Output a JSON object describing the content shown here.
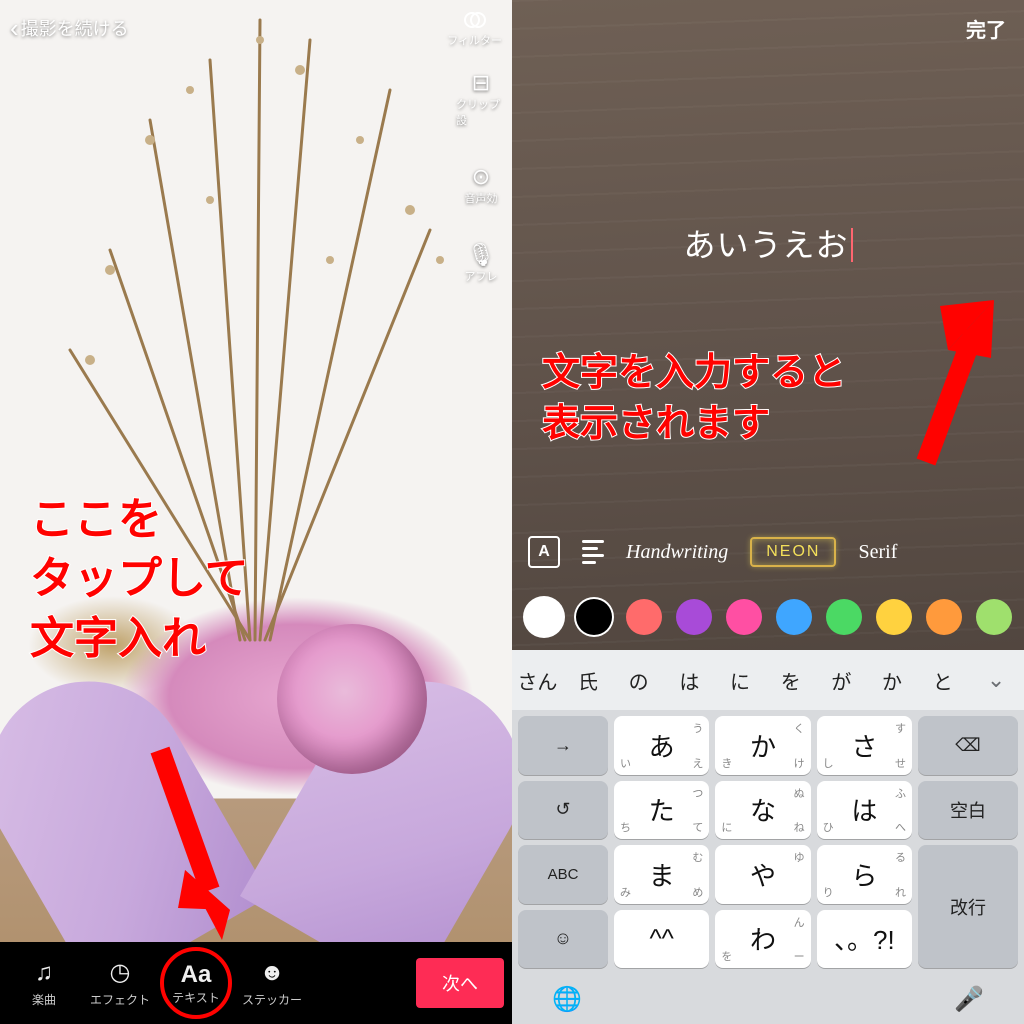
{
  "left": {
    "header": {
      "continue": "撮影を続ける",
      "filter": "フィルター"
    },
    "side_tools": {
      "clip": "クリップ設",
      "voice": "音声効",
      "afrec": "アフレ"
    },
    "bottom": {
      "music": "楽曲",
      "effect": "エフェクト",
      "text": "テキスト",
      "text_icon": "Aa",
      "sticker": "ステッカー",
      "next": "次へ"
    },
    "annotation": "ここを\nタップして\n文字入れ"
  },
  "right": {
    "done": "完了",
    "input_text": "あいうえお",
    "annotation": "文字を入力すると\n表示されます",
    "styles": {
      "boxA": "A",
      "hand": "Handwriting",
      "neon": "NEON",
      "serif": "Serif"
    },
    "colors": [
      "#ffffff",
      "#000000",
      "#ff6b6b",
      "#a84bd8",
      "#ff4fa3",
      "#3fa6ff",
      "#4bd964",
      "#ffd23f",
      "#ff9a3c",
      "#9fe06d",
      "#ff7f9e"
    ],
    "predictions": [
      "さん",
      "氏",
      "の",
      "は",
      "に",
      "を",
      "が",
      "か",
      "と"
    ],
    "keys": {
      "r1": [
        "→",
        "あ",
        "か",
        "さ",
        "⌫"
      ],
      "r2": [
        "↺",
        "た",
        "な",
        "は",
        "空白"
      ],
      "r3": [
        "ABC",
        "ま",
        "や",
        "ら",
        "改行"
      ],
      "r4": [
        "☺",
        "^^",
        "わ",
        "、。?!",
        ""
      ],
      "subs": {
        "あ": [
          "",
          "う",
          "い",
          "え"
        ],
        "か": [
          "",
          "く",
          "き",
          "け"
        ],
        "さ": [
          "",
          "す",
          "し",
          "せ"
        ],
        "た": [
          "",
          "つ",
          "ち",
          "て"
        ],
        "な": [
          "",
          "ぬ",
          "に",
          "ね"
        ],
        "は": [
          "",
          "ふ",
          "ひ",
          "へ"
        ],
        "ま": [
          "",
          "む",
          "み",
          "め"
        ],
        "や": [
          "",
          "ゆ",
          "",
          ""
        ],
        "ら": [
          "",
          "る",
          "り",
          "れ"
        ],
        "わ": [
          "",
          "ん",
          "を",
          "ー"
        ]
      }
    },
    "kb_footer": {
      "globe": "🌐",
      "mic": "🎤"
    }
  }
}
